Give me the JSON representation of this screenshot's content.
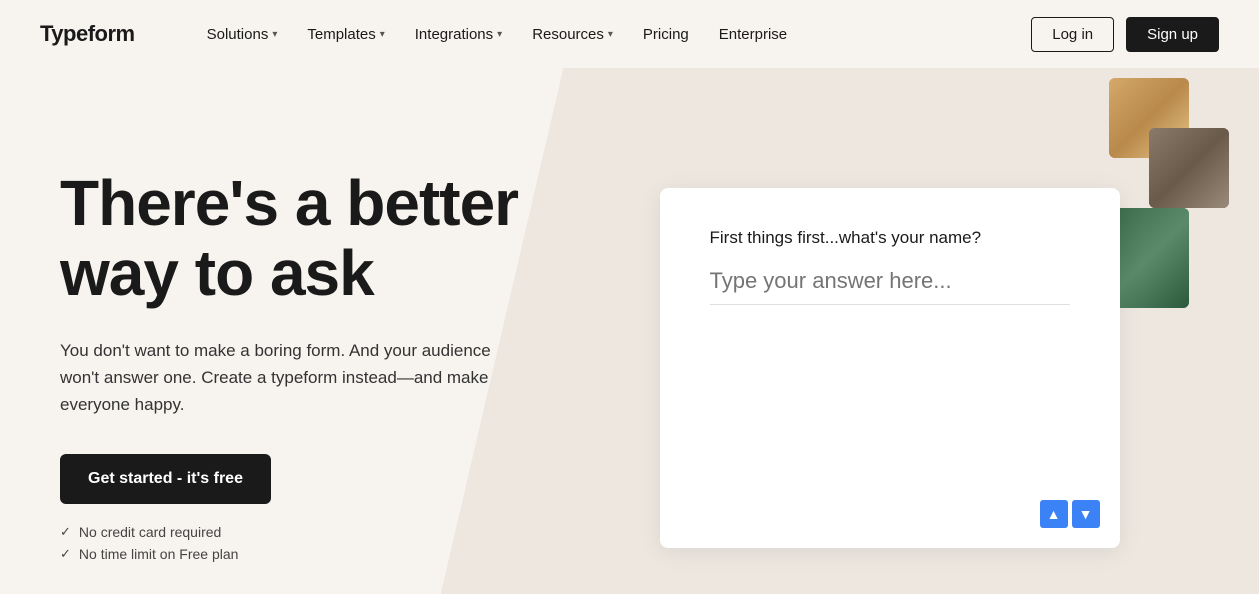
{
  "nav": {
    "logo": "Typeform",
    "items": [
      {
        "label": "Solutions",
        "hasDropdown": true
      },
      {
        "label": "Templates",
        "hasDropdown": true
      },
      {
        "label": "Integrations",
        "hasDropdown": true
      },
      {
        "label": "Resources",
        "hasDropdown": true
      },
      {
        "label": "Pricing",
        "hasDropdown": false
      },
      {
        "label": "Enterprise",
        "hasDropdown": false
      }
    ],
    "login_label": "Log in",
    "signup_label": "Sign up"
  },
  "hero": {
    "title": "There's a better way to ask",
    "subtitle": "You don't want to make a boring form. And your audience won't answer one. Create a typeform instead—and make everyone happy.",
    "cta_label": "Get started - it's free",
    "checklist": [
      "No credit card required",
      "No time limit on Free plan"
    ]
  },
  "form_preview": {
    "question": "First things first...what's your name?",
    "input_placeholder": "Type your answer here...",
    "nav_up": "▲",
    "nav_down": "▼"
  }
}
